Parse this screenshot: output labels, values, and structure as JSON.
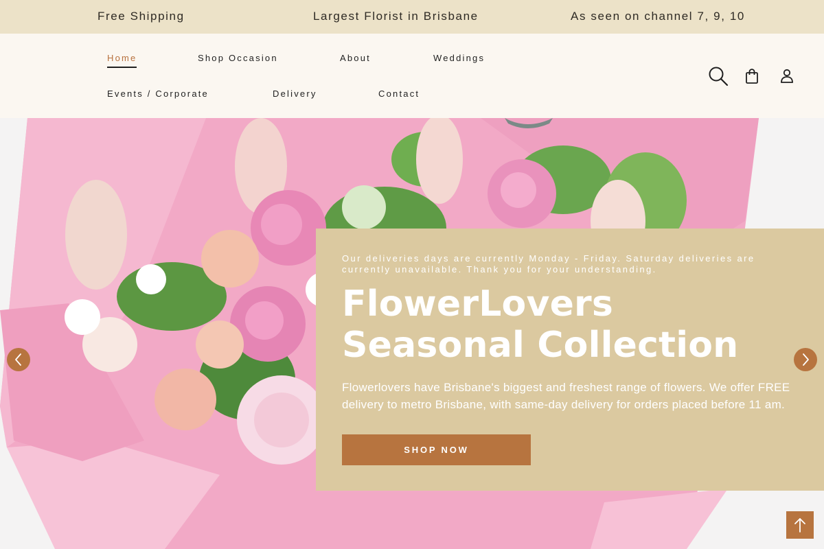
{
  "announcement": {
    "items": [
      "Free Shipping",
      "Largest Florist in Brisbane",
      "As seen on channel 7, 9, 10"
    ]
  },
  "nav": {
    "items": [
      {
        "label": "Home",
        "active": true
      },
      {
        "label": "Shop Occasion",
        "active": false
      },
      {
        "label": "About",
        "active": false
      },
      {
        "label": "Weddings",
        "active": false
      },
      {
        "label": "Events / Corporate",
        "active": false
      },
      {
        "label": "Delivery",
        "active": false
      },
      {
        "label": "Contact",
        "active": false
      }
    ]
  },
  "header_icons": [
    "search-icon",
    "shopping-bag-icon",
    "account-icon"
  ],
  "hero": {
    "notice": "Our deliveries days are currently Monday - Friday. Saturday deliveries are currently unavailable. Thank you for your understanding.",
    "title": "FlowerLovers Seasonal Collection",
    "description": "Flowerlovers have Brisbane's biggest and freshest range of flowers. We offer FREE delivery to metro Brisbane, with same-day delivery for orders placed before 11 am.",
    "cta_label": "SHOP NOW"
  },
  "slider": {
    "prev_icon": "chevron-left-icon",
    "next_icon": "chevron-right-icon"
  },
  "back_to_top_icon": "arrow-up-icon",
  "colors": {
    "announcement_bg": "#ece2c8",
    "header_bg": "#fbf7f1",
    "accent": "#b7743f",
    "panel_bg": "#dbc9a0",
    "wrap_pink": "#f2a9c6"
  }
}
